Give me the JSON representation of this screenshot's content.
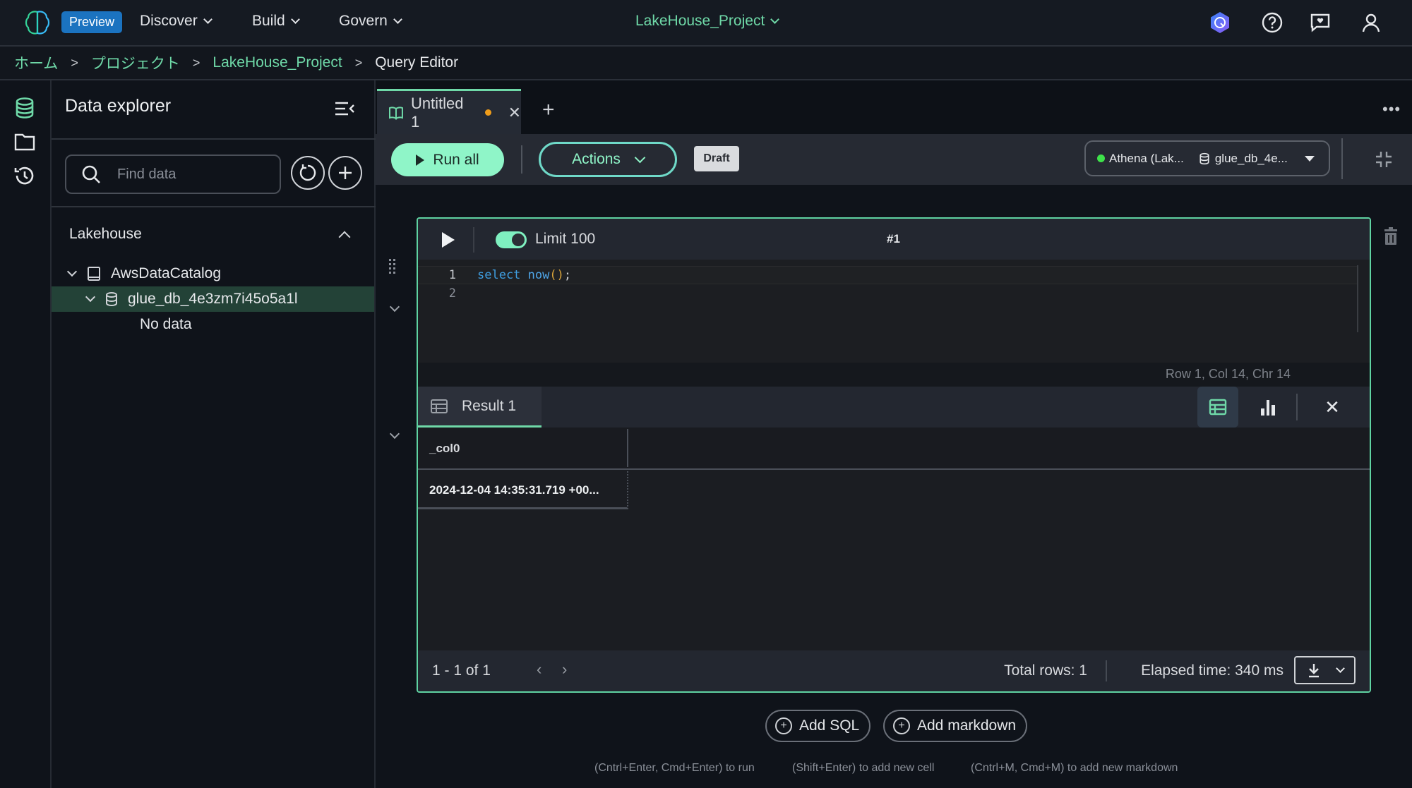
{
  "topbar": {
    "preview_badge": "Preview",
    "nav": [
      {
        "label": "Discover"
      },
      {
        "label": "Build"
      },
      {
        "label": "Govern"
      }
    ],
    "project_selector": "LakeHouse_Project"
  },
  "breadcrumb": {
    "items": [
      "ホーム",
      "プロジェクト",
      "LakeHouse_Project"
    ],
    "current": "Query Editor"
  },
  "sidebar": {
    "title": "Data explorer",
    "search_placeholder": "Find data",
    "section": "Lakehouse",
    "tree": [
      {
        "label": "AwsDataCatalog",
        "icon": "catalog-icon",
        "expanded": true
      },
      {
        "label": "glue_db_4e3zm7i45o5a1l",
        "icon": "database-icon",
        "expanded": true,
        "selected": true
      },
      {
        "label": "No data"
      }
    ]
  },
  "tabs": [
    {
      "label": "Untitled 1",
      "unsaved": true,
      "active": true
    }
  ],
  "toolbar": {
    "run_all": "Run all",
    "actions": "Actions",
    "status_badge": "Draft",
    "connection": "Athena (Lak...",
    "database": "glue_db_4e..."
  },
  "cell": {
    "limit_enabled": true,
    "limit_label": "Limit 100",
    "cell_number": "#1",
    "code_lines": [
      {
        "num": "1",
        "tokens": [
          {
            "t": "select",
            "c": "kw"
          },
          {
            "t": " ",
            "c": "punc"
          },
          {
            "t": "now",
            "c": "fn"
          },
          {
            "t": "()",
            "c": "paren"
          },
          {
            "t": ";",
            "c": "punc"
          }
        ]
      },
      {
        "num": "2",
        "tokens": []
      }
    ],
    "cursor_status": "Row 1,  Col 14,  Chr 14"
  },
  "result": {
    "tab_label": "Result 1",
    "columns": [
      "_col0"
    ],
    "rows": [
      [
        "2024-12-04 14:35:31.719 +00..."
      ]
    ],
    "pager": "1 - 1 of 1",
    "total_rows": "Total rows: 1",
    "elapsed": "Elapsed time: 340 ms",
    "active_view": "table"
  },
  "footer": {
    "add_sql": "Add SQL",
    "add_markdown": "Add markdown",
    "hints": [
      "(Cntrl+Enter, Cmd+Enter) to run",
      "(Shift+Enter) to add new cell",
      "(Cntrl+M, Cmd+M) to add new markdown"
    ]
  },
  "colors": {
    "accent": "#6fd9a8",
    "run_button": "#8ff5c8",
    "preview_badge": "#1b73c0",
    "unsaved_dot": "#f09d1a",
    "connection_ok": "#3ee24a"
  }
}
